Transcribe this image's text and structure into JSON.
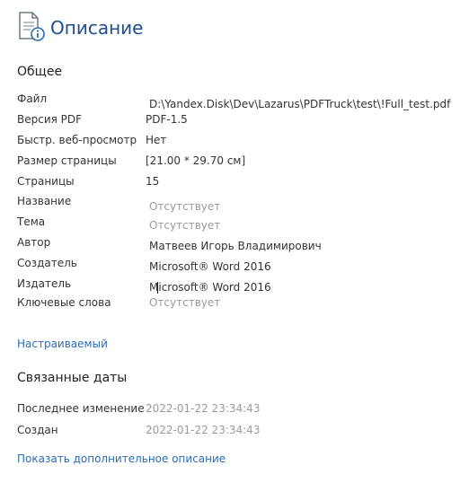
{
  "header": {
    "icon": "document-info-icon",
    "title": "Описание"
  },
  "general": {
    "title": "Общее",
    "rows": [
      {
        "label": "Файл",
        "value": "D:\\Yandex.Disk\\Dev\\Lazarus\\PDFTruck\\test\\!Full_test.pdf",
        "muted": false
      },
      {
        "label": "Версия PDF",
        "value": "PDF-1.5",
        "muted": false
      },
      {
        "label": "Быстр. веб-просмотр",
        "value": "Нет",
        "muted": false
      },
      {
        "label": "Размер страницы",
        "value": "[21.00 * 29.70 см]",
        "muted": false
      },
      {
        "label": "Страницы",
        "value": "15",
        "muted": false
      },
      {
        "label": "Название",
        "value": "Отсутствует",
        "muted": true
      },
      {
        "label": "Тема",
        "value": "Отсутствует",
        "muted": true
      },
      {
        "label": "Автор",
        "value": "Матвеев Игорь Владимирович",
        "muted": false
      },
      {
        "label": "Создатель",
        "value": "Microsoft® Word 2016",
        "muted": false
      },
      {
        "label": "Издатель",
        "value": "Microsoft® Word 2016",
        "muted": false
      },
      {
        "label": "Ключевые слова",
        "value": "Отсутствует",
        "muted": true
      }
    ]
  },
  "custom_link": "Настраиваемый",
  "dates": {
    "title": "Связанные даты",
    "rows": [
      {
        "label": "Последнее изменение",
        "value": "2022-01-22 23:34:43",
        "muted": true
      },
      {
        "label": "Создан",
        "value": "2022-01-22 23:34:43",
        "muted": true
      }
    ]
  },
  "more_link": "Показать дополнительное описание",
  "colors": {
    "title": "#1f4e8c",
    "link": "#2b6cb0",
    "muted": "#9a9a9a"
  }
}
